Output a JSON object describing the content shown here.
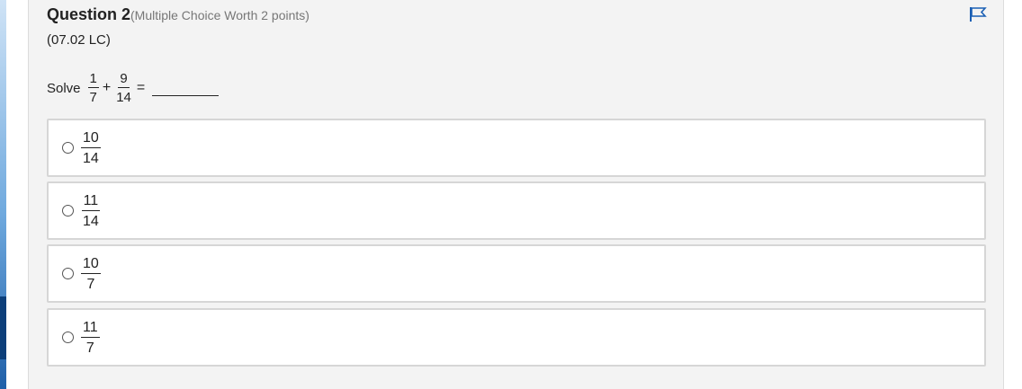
{
  "question": {
    "title": "Question 2",
    "worth": "(Multiple Choice Worth 2 points)",
    "code": "(07.02 LC)",
    "prompt_lead": "Solve",
    "term1": {
      "num": "1",
      "den": "7"
    },
    "operator": "+",
    "term2": {
      "num": "9",
      "den": "14"
    },
    "equals": "=",
    "flag_icon": "flag-icon"
  },
  "options": [
    {
      "num": "10",
      "den": "14"
    },
    {
      "num": "11",
      "den": "14"
    },
    {
      "num": "10",
      "den": "7"
    },
    {
      "num": "11",
      "den": "7"
    }
  ],
  "colors": {
    "panel_bg": "#f3f3f3",
    "option_border": "#d6d6d6",
    "flag": "#1a5fb4"
  }
}
